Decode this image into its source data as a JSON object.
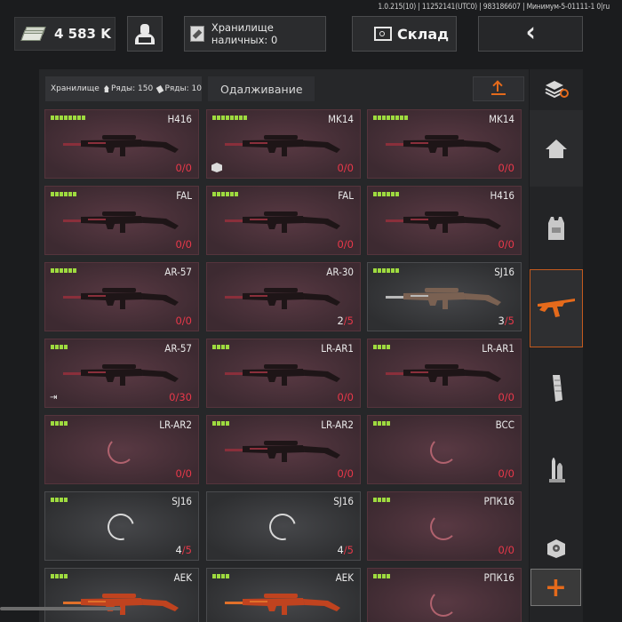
{
  "version": "1.0.215(10) | 11252141(UTC0) | 983186607 | Минимум-5-01111-1 0|ru",
  "header": {
    "money": "4 583 K",
    "cash_storage_label": "Хранилище наличных: 0",
    "warehouse_label": "Склад",
    "back_icon": "‹"
  },
  "storage": {
    "label": "Хранилище",
    "rows_house": "Ряды: 150",
    "rows_ticket": "Ряды: 10",
    "loan_tab": "Одалживание"
  },
  "cards": [
    {
      "name": "H416",
      "count_left": "0",
      "count_right": "/0",
      "style": "red",
      "level": 8,
      "icon": "rifle"
    },
    {
      "name": "MK14",
      "count_left": "0",
      "count_right": "/0",
      "style": "red",
      "level": 8,
      "icon": "rifle",
      "corner": "box"
    },
    {
      "name": "MK14",
      "count_left": "0",
      "count_right": "/0",
      "style": "red",
      "level": 8,
      "icon": "rifle"
    },
    {
      "name": "FAL",
      "count_left": "0",
      "count_right": "/0",
      "style": "red",
      "level": 6,
      "icon": "rifle"
    },
    {
      "name": "FAL",
      "count_left": "0",
      "count_right": "/0",
      "style": "red",
      "level": 6,
      "icon": "rifle"
    },
    {
      "name": "H416",
      "count_left": "0",
      "count_right": "/0",
      "style": "red",
      "level": 6,
      "icon": "rifle"
    },
    {
      "name": "AR-57",
      "count_left": "0",
      "count_right": "/0",
      "style": "red",
      "level": 6,
      "icon": "rifle"
    },
    {
      "name": "AR-30",
      "count_left": "2",
      "count_right": "/5",
      "style": "red",
      "level": 0,
      "icon": "rifle",
      "left_white": true
    },
    {
      "name": "SJ16",
      "count_left": "3",
      "count_right": "/5",
      "style": "gray",
      "level": 6,
      "icon": "rifle-wood",
      "left_white": true
    },
    {
      "name": "AR-57",
      "count_left": "0",
      "count_right": "/30",
      "style": "red",
      "level": 4,
      "icon": "rifle",
      "corner": "arrow"
    },
    {
      "name": "LR-AR1",
      "count_left": "0",
      "count_right": "/0",
      "style": "red",
      "level": 4,
      "icon": "rifle"
    },
    {
      "name": "LR-AR1",
      "count_left": "0",
      "count_right": "/0",
      "style": "red",
      "level": 4,
      "icon": "rifle"
    },
    {
      "name": "LR-AR2",
      "count_left": "0",
      "count_right": "/0",
      "style": "red",
      "level": 4,
      "icon": "spinner"
    },
    {
      "name": "LR-AR2",
      "count_left": "0",
      "count_right": "/0",
      "style": "red",
      "level": 4,
      "icon": "rifle"
    },
    {
      "name": "BCC",
      "count_left": "0",
      "count_right": "/0",
      "style": "red",
      "level": 4,
      "icon": "spinner"
    },
    {
      "name": "SJ16",
      "count_left": "4",
      "count_right": "/5",
      "style": "gray",
      "level": 4,
      "icon": "spinner",
      "left_white": true
    },
    {
      "name": "SJ16",
      "count_left": "4",
      "count_right": "/5",
      "style": "gray",
      "level": 0,
      "icon": "spinner",
      "left_white": true
    },
    {
      "name": "РПК16",
      "count_left": "0",
      "count_right": "/0",
      "style": "red",
      "level": 4,
      "icon": "spinner"
    },
    {
      "name": "AEK",
      "count_left": "",
      "count_right": "",
      "style": "gray",
      "level": 4,
      "icon": "rifle-orange"
    },
    {
      "name": "AEK",
      "count_left": "",
      "count_right": "",
      "style": "gray",
      "level": 4,
      "icon": "rifle-orange"
    },
    {
      "name": "РПК16",
      "count_left": "",
      "count_right": "",
      "style": "red",
      "level": 4,
      "icon": "spinner"
    }
  ],
  "sidebar": {
    "items": [
      "storage-sort-icon",
      "home-icon",
      "vest-icon",
      "rifle-icon",
      "magazine-icon",
      "ammo-icon",
      "sight-icon"
    ],
    "plus": "+"
  }
}
